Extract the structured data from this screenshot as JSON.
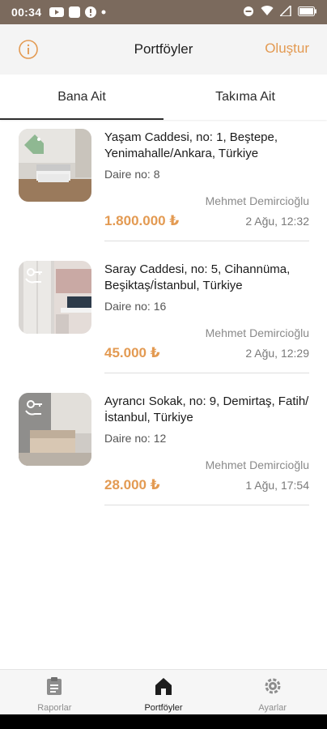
{
  "status_bar": {
    "time": "00:34"
  },
  "nav": {
    "title": "Portföyler",
    "create_label": "Oluştur"
  },
  "tabs": [
    {
      "label": "Bana Ait",
      "active": true
    },
    {
      "label": "Takıma Ait",
      "active": false
    }
  ],
  "items": [
    {
      "address": "Yaşam Caddesi, no: 1, Beştepe, Yenimahalle/Ankara, Türkiye",
      "apartment": "Daire no: 8",
      "owner": "Mehmet Demircioğlu",
      "price": "1.800.000 ₺",
      "date": "2 Ağu, 12:32",
      "tag_icon": "for-sale-tag-icon"
    },
    {
      "address": "Saray Caddesi, no: 5, Cihannüma, Beşiktaş/İstanbul, Türkiye",
      "apartment": "Daire no: 16",
      "owner": "Mehmet Demircioğlu",
      "price": "45.000 ₺",
      "date": "2 Ağu, 12:29",
      "tag_icon": "for-rent-key-icon"
    },
    {
      "address": "Ayrancı Sokak, no: 9, Demirtaş, Fatih/İstanbul, Türkiye",
      "apartment": "Daire no: 12",
      "owner": "Mehmet Demircioğlu",
      "price": "28.000 ₺",
      "date": "1 Ağu, 17:54",
      "tag_icon": "for-rent-key-icon"
    }
  ],
  "bottom_nav": [
    {
      "label": "Raporlar",
      "icon": "clipboard-icon",
      "active": false
    },
    {
      "label": "Portföyler",
      "icon": "home-icon",
      "active": true
    },
    {
      "label": "Ayarlar",
      "icon": "gear-icon",
      "active": false
    }
  ],
  "colors": {
    "accent": "#e39a52",
    "status_bar": "#7b6a5d"
  }
}
